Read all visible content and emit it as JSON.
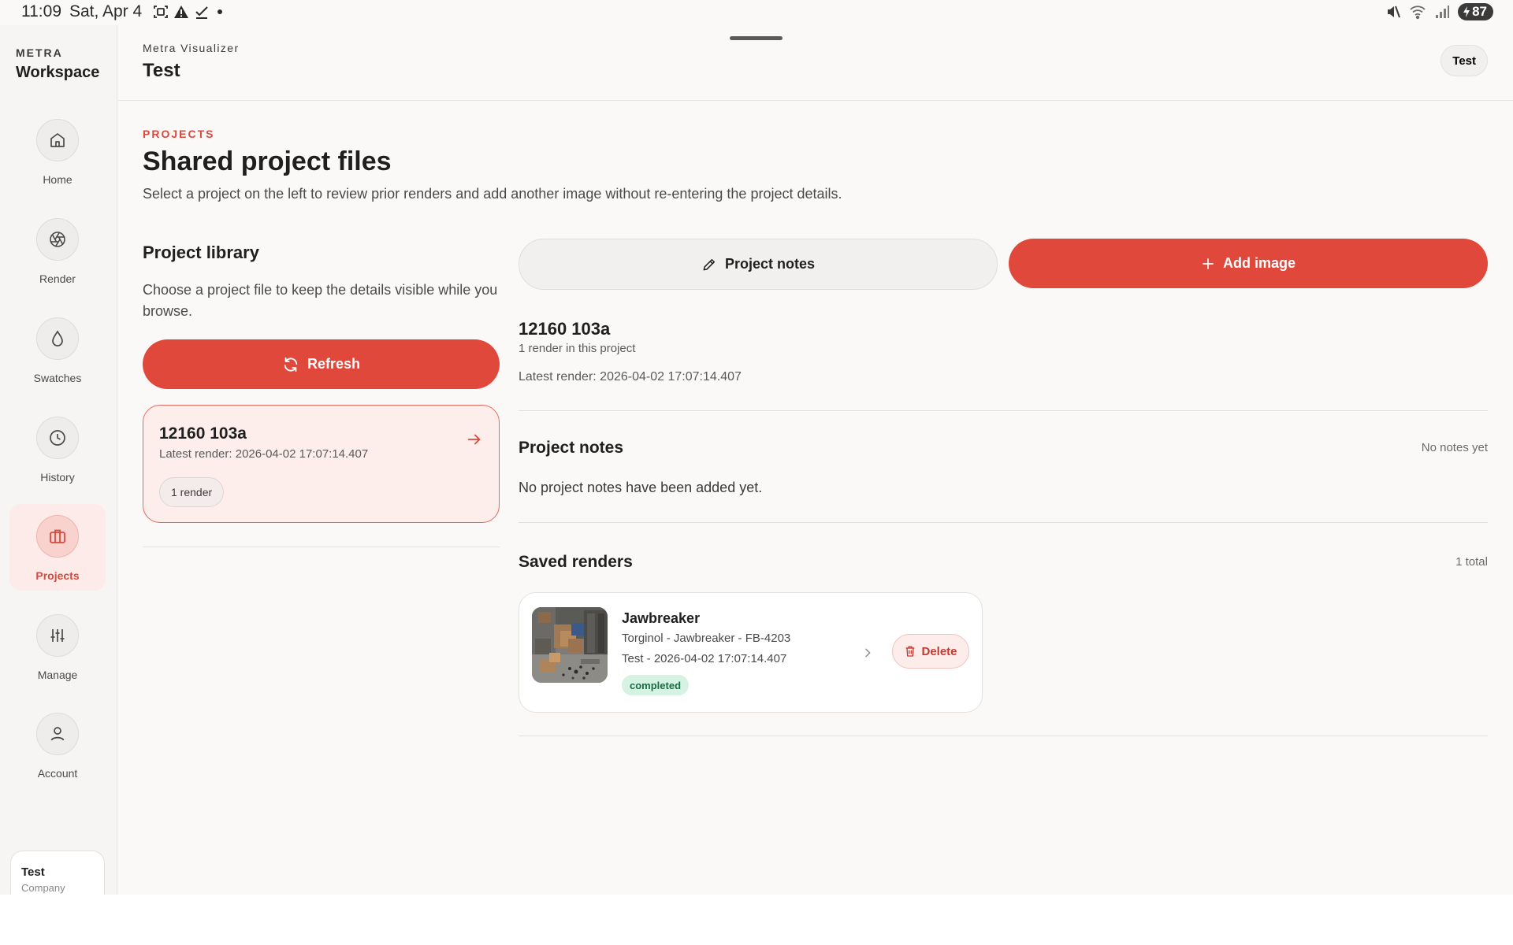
{
  "status_bar": {
    "time": "11:09",
    "date": "Sat, Apr 4",
    "battery": "87",
    "left_icons": [
      "screenshot-icon",
      "warning-icon",
      "check-icon",
      "dot-icon"
    ],
    "right_icons": [
      "mute-icon",
      "wifi-icon",
      "signal-icon",
      "battery-icon"
    ]
  },
  "sidebar": {
    "brand_small": "METRA",
    "brand_big": "Workspace",
    "items": [
      {
        "label": "Home",
        "icon": "home-icon"
      },
      {
        "label": "Render",
        "icon": "aperture-icon"
      },
      {
        "label": "Swatches",
        "icon": "droplet-icon"
      },
      {
        "label": "History",
        "icon": "clock-icon"
      },
      {
        "label": "Projects",
        "icon": "briefcase-icon",
        "active": true
      },
      {
        "label": "Manage",
        "icon": "sliders-icon"
      },
      {
        "label": "Account",
        "icon": "user-icon"
      }
    ],
    "user_card": {
      "name": "Test",
      "subtitle": "Company"
    }
  },
  "header": {
    "subtitle": "Metra Visualizer",
    "title": "Test",
    "user_button": "Test"
  },
  "main": {
    "eyebrow": "PROJECTS",
    "title": "Shared project files",
    "description": "Select a project on the left to review prior renders and add another image without re-entering the project details."
  },
  "library": {
    "title": "Project library",
    "description": "Choose a project file to keep the details visible while you browse.",
    "refresh_label": "Refresh",
    "projects": [
      {
        "name": "12160 103a",
        "latest": "Latest render: 2026-04-02 17:07:14.407",
        "badge": "1 render"
      }
    ]
  },
  "detail": {
    "notes_button": "Project notes",
    "add_button": "Add image",
    "project_name": "12160 103a",
    "render_count": "1 render in this project",
    "latest_render": "Latest render: 2026-04-02 17:07:14.407",
    "notes_section": {
      "title": "Project notes",
      "meta": "No notes yet",
      "empty_text": "No project notes have been added yet."
    },
    "renders_section": {
      "title": "Saved renders",
      "meta": "1 total",
      "items": [
        {
          "name": "Jawbreaker",
          "line1": "Torginol - Jawbreaker - FB-4203",
          "line2": "Test - 2026-04-02 17:07:14.407",
          "status": "completed",
          "delete_label": "Delete"
        }
      ]
    }
  },
  "colors": {
    "accent": "#e0483c",
    "accent_soft": "#fdeeec",
    "status_green_bg": "#d5f2e3",
    "status_green_text": "#1b6b45"
  }
}
